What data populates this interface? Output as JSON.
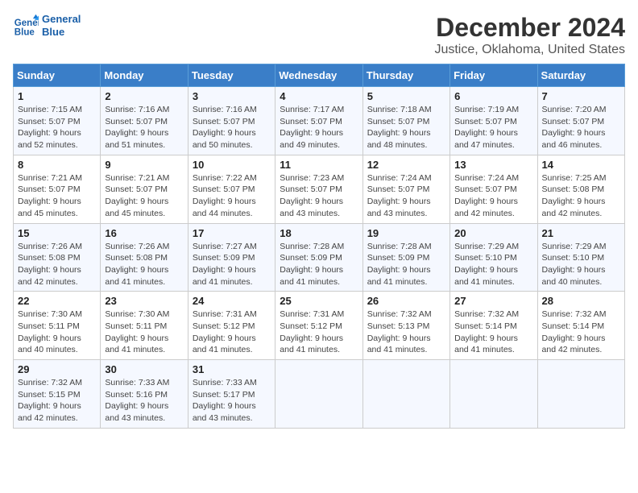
{
  "header": {
    "logo_line1": "General",
    "logo_line2": "Blue",
    "title": "December 2024",
    "subtitle": "Justice, Oklahoma, United States"
  },
  "days_of_week": [
    "Sunday",
    "Monday",
    "Tuesday",
    "Wednesday",
    "Thursday",
    "Friday",
    "Saturday"
  ],
  "weeks": [
    [
      {
        "num": "1",
        "rise": "7:15 AM",
        "set": "5:07 PM",
        "daylight": "9 hours and 52 minutes."
      },
      {
        "num": "2",
        "rise": "7:16 AM",
        "set": "5:07 PM",
        "daylight": "9 hours and 51 minutes."
      },
      {
        "num": "3",
        "rise": "7:16 AM",
        "set": "5:07 PM",
        "daylight": "9 hours and 50 minutes."
      },
      {
        "num": "4",
        "rise": "7:17 AM",
        "set": "5:07 PM",
        "daylight": "9 hours and 49 minutes."
      },
      {
        "num": "5",
        "rise": "7:18 AM",
        "set": "5:07 PM",
        "daylight": "9 hours and 48 minutes."
      },
      {
        "num": "6",
        "rise": "7:19 AM",
        "set": "5:07 PM",
        "daylight": "9 hours and 47 minutes."
      },
      {
        "num": "7",
        "rise": "7:20 AM",
        "set": "5:07 PM",
        "daylight": "9 hours and 46 minutes."
      }
    ],
    [
      {
        "num": "8",
        "rise": "7:21 AM",
        "set": "5:07 PM",
        "daylight": "9 hours and 45 minutes."
      },
      {
        "num": "9",
        "rise": "7:21 AM",
        "set": "5:07 PM",
        "daylight": "9 hours and 45 minutes."
      },
      {
        "num": "10",
        "rise": "7:22 AM",
        "set": "5:07 PM",
        "daylight": "9 hours and 44 minutes."
      },
      {
        "num": "11",
        "rise": "7:23 AM",
        "set": "5:07 PM",
        "daylight": "9 hours and 43 minutes."
      },
      {
        "num": "12",
        "rise": "7:24 AM",
        "set": "5:07 PM",
        "daylight": "9 hours and 43 minutes."
      },
      {
        "num": "13",
        "rise": "7:24 AM",
        "set": "5:07 PM",
        "daylight": "9 hours and 42 minutes."
      },
      {
        "num": "14",
        "rise": "7:25 AM",
        "set": "5:08 PM",
        "daylight": "9 hours and 42 minutes."
      }
    ],
    [
      {
        "num": "15",
        "rise": "7:26 AM",
        "set": "5:08 PM",
        "daylight": "9 hours and 42 minutes."
      },
      {
        "num": "16",
        "rise": "7:26 AM",
        "set": "5:08 PM",
        "daylight": "9 hours and 41 minutes."
      },
      {
        "num": "17",
        "rise": "7:27 AM",
        "set": "5:09 PM",
        "daylight": "9 hours and 41 minutes."
      },
      {
        "num": "18",
        "rise": "7:28 AM",
        "set": "5:09 PM",
        "daylight": "9 hours and 41 minutes."
      },
      {
        "num": "19",
        "rise": "7:28 AM",
        "set": "5:09 PM",
        "daylight": "9 hours and 41 minutes."
      },
      {
        "num": "20",
        "rise": "7:29 AM",
        "set": "5:10 PM",
        "daylight": "9 hours and 41 minutes."
      },
      {
        "num": "21",
        "rise": "7:29 AM",
        "set": "5:10 PM",
        "daylight": "9 hours and 40 minutes."
      }
    ],
    [
      {
        "num": "22",
        "rise": "7:30 AM",
        "set": "5:11 PM",
        "daylight": "9 hours and 40 minutes."
      },
      {
        "num": "23",
        "rise": "7:30 AM",
        "set": "5:11 PM",
        "daylight": "9 hours and 41 minutes."
      },
      {
        "num": "24",
        "rise": "7:31 AM",
        "set": "5:12 PM",
        "daylight": "9 hours and 41 minutes."
      },
      {
        "num": "25",
        "rise": "7:31 AM",
        "set": "5:12 PM",
        "daylight": "9 hours and 41 minutes."
      },
      {
        "num": "26",
        "rise": "7:32 AM",
        "set": "5:13 PM",
        "daylight": "9 hours and 41 minutes."
      },
      {
        "num": "27",
        "rise": "7:32 AM",
        "set": "5:14 PM",
        "daylight": "9 hours and 41 minutes."
      },
      {
        "num": "28",
        "rise": "7:32 AM",
        "set": "5:14 PM",
        "daylight": "9 hours and 42 minutes."
      }
    ],
    [
      {
        "num": "29",
        "rise": "7:32 AM",
        "set": "5:15 PM",
        "daylight": "9 hours and 42 minutes."
      },
      {
        "num": "30",
        "rise": "7:33 AM",
        "set": "5:16 PM",
        "daylight": "9 hours and 43 minutes."
      },
      {
        "num": "31",
        "rise": "7:33 AM",
        "set": "5:17 PM",
        "daylight": "9 hours and 43 minutes."
      },
      null,
      null,
      null,
      null
    ]
  ]
}
